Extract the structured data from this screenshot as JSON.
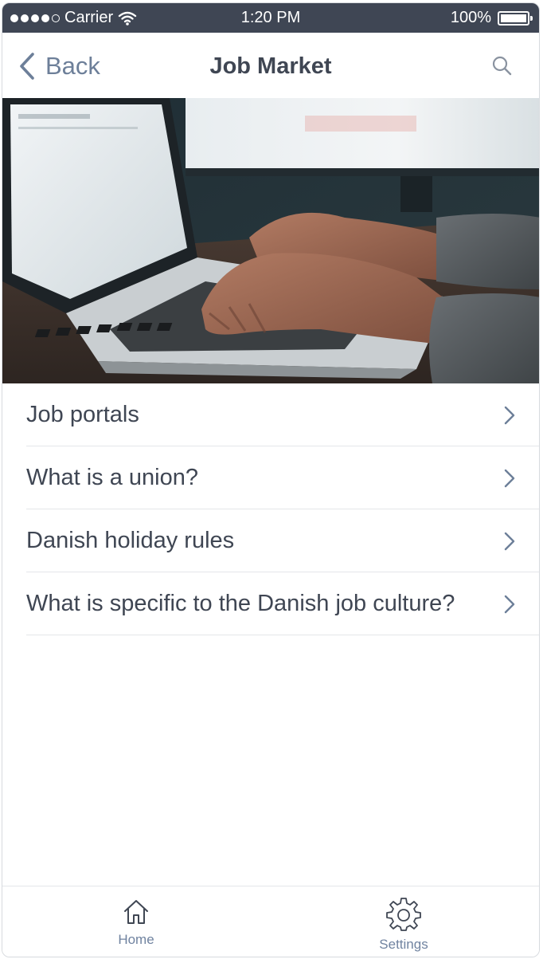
{
  "status_bar": {
    "carrier": "Carrier",
    "time": "1:20 PM",
    "battery": "100%",
    "battery_level": 1.0
  },
  "nav": {
    "back_label": "Back",
    "title": "Job Market",
    "search_icon": "search-icon"
  },
  "hero": {
    "description_icon": "laptop-typing-photo"
  },
  "list": {
    "items": [
      {
        "label": "Job portals"
      },
      {
        "label": "What is a union?"
      },
      {
        "label": "Danish holiday rules"
      },
      {
        "label": "What is specific to the Danish job culture?"
      }
    ]
  },
  "tab_bar": {
    "home_label": "Home",
    "settings_label": "Settings",
    "home_icon": "home-icon",
    "settings_icon": "gear-icon"
  },
  "colors": {
    "status_bar_bg": "#3f4654",
    "accent": "#6d7f99",
    "text": "#3f4653",
    "divider": "#e4e6e9"
  }
}
